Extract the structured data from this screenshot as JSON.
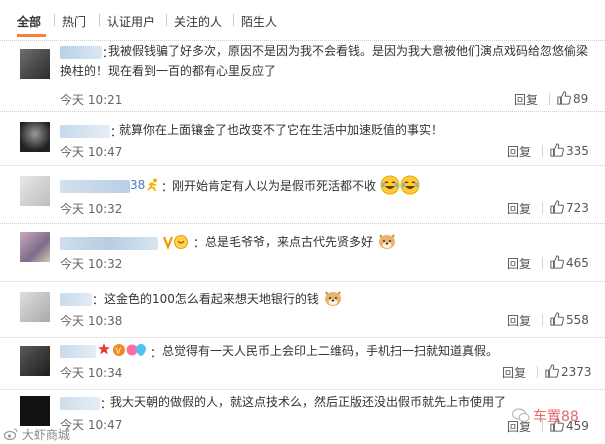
{
  "tabs": [
    {
      "label": "全部"
    },
    {
      "label": "热门"
    },
    {
      "label": "认证用户"
    },
    {
      "label": "关注的人"
    },
    {
      "label": "陌生人"
    }
  ],
  "comments": [
    {
      "text": "我被假钱骗了好多次，原因不是因为我不会看钱。是因为我大意被他们演点戏码给忽悠偷梁换柱的！现在看到一百的都有心里反应了",
      "time": "今天 10:21",
      "reply": "回复",
      "likes": "89"
    },
    {
      "text": "就算你在上面镶金了也改变不了它在生活中加速贬值的事实！",
      "time": "今天 10:47",
      "reply": "回复",
      "likes": "335"
    },
    {
      "name_suffix": "38",
      "text": "刚开始肯定有人以为是假币死活都不收",
      "time": "今天 10:32",
      "reply": "回复",
      "likes": "723"
    },
    {
      "text": "总是毛爷爷，来点古代先贤多好",
      "time": "今天 10:32",
      "reply": "回复",
      "likes": "465"
    },
    {
      "text": "这金色的100怎么看起来想天地银行的钱",
      "time": "今天 10:38",
      "reply": "回复",
      "likes": "558"
    },
    {
      "text": "总觉得有一天人民币上会印上二维码，手机扫一扫就知道真假。",
      "time": "今天 10:34",
      "reply": "回复",
      "likes": "2373"
    },
    {
      "text": "我大天朝的做假的人，就这点技术么，然后正版还没出假币就先上市使用了",
      "time": "今天 10:47",
      "reply": "回复",
      "likes": "459"
    }
  ],
  "watermarks": {
    "bottom_left": "大虾商城",
    "bottom_right": "车置88"
  },
  "colors": {
    "accent": "#fa7d3c",
    "like_icon": "#666666"
  }
}
